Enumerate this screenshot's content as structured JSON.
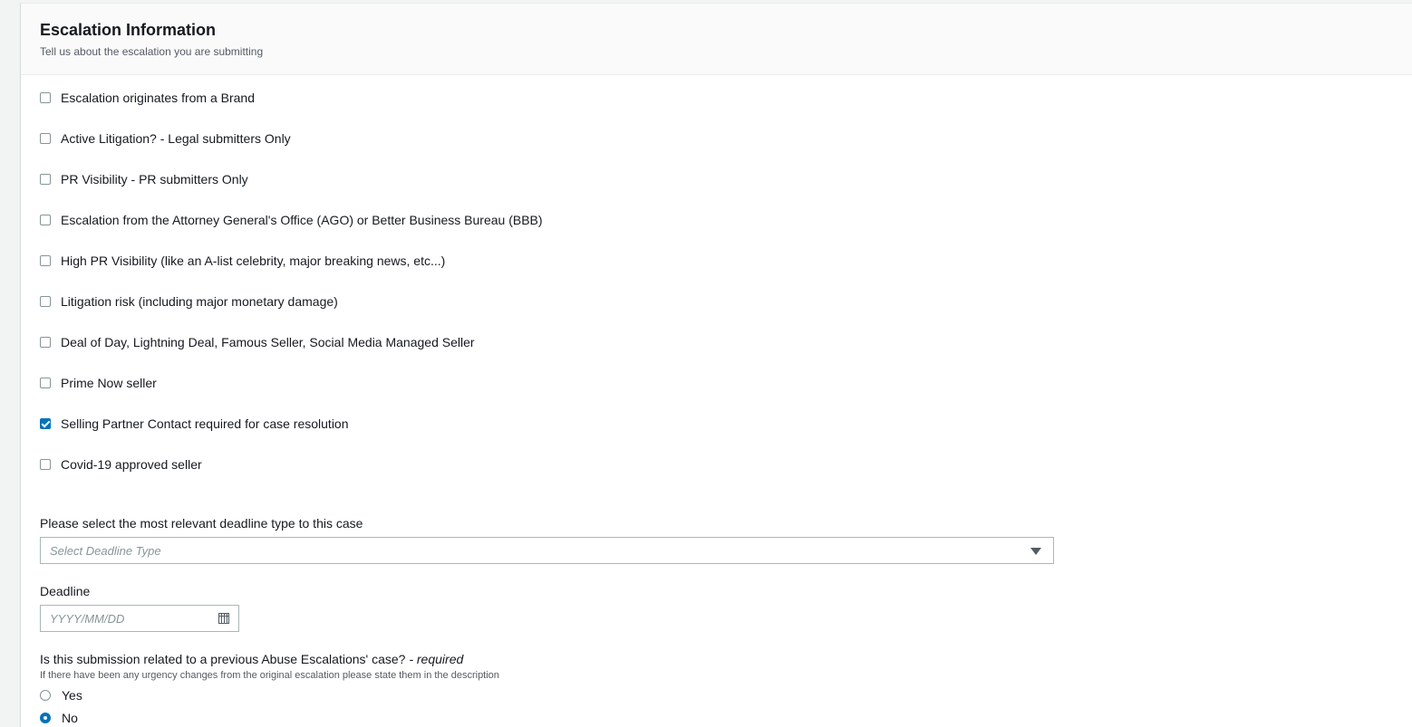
{
  "section": {
    "title": "Escalation Information",
    "description": "Tell us about the escalation you are submitting"
  },
  "checkboxes": [
    {
      "label": "Escalation originates from a Brand",
      "checked": false
    },
    {
      "label": "Active Litigation? - Legal submitters Only",
      "checked": false
    },
    {
      "label": "PR Visibility - PR submitters Only",
      "checked": false
    },
    {
      "label": "Escalation from the Attorney General's Office (AGO) or Better Business Bureau (BBB)",
      "checked": false
    },
    {
      "label": "High PR Visibility (like an A-list celebrity, major breaking news, etc...)",
      "checked": false
    },
    {
      "label": "Litigation risk (including major monetary damage)",
      "checked": false
    },
    {
      "label": "Deal of Day, Lightning Deal, Famous Seller, Social Media Managed Seller",
      "checked": false
    },
    {
      "label": "Prime Now seller",
      "checked": false
    },
    {
      "label": "Selling Partner Contact required for case resolution",
      "checked": true
    },
    {
      "label": "Covid-19 approved seller",
      "checked": false
    }
  ],
  "deadline_type": {
    "label": "Please select the most relevant deadline type to this case",
    "placeholder": "Select Deadline Type"
  },
  "deadline": {
    "label": "Deadline",
    "placeholder": "YYYY/MM/DD"
  },
  "previous_case": {
    "question": "Is this submission related to a previous Abuse Escalations' case?",
    "required_suffix": "- required",
    "hint": "If there have been any urgency changes from the original escalation please state them in the description",
    "options": [
      {
        "label": "Yes",
        "selected": false
      },
      {
        "label": "No",
        "selected": true
      }
    ]
  }
}
